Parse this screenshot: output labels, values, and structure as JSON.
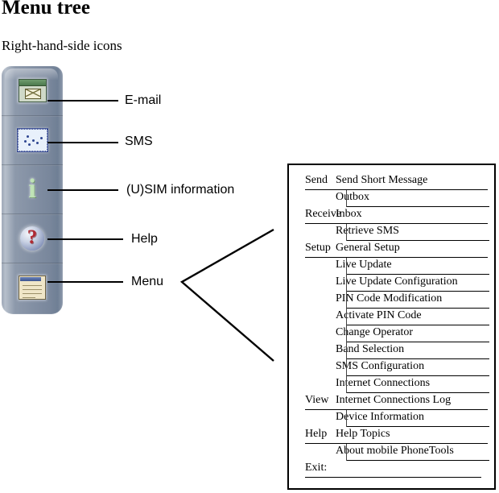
{
  "page": {
    "title": "Menu tree",
    "subtitle": "Right-hand-side icons"
  },
  "toolbar": {
    "name": "right-hand-side-icon-bar",
    "buttons": [
      {
        "icon": "email-icon",
        "label": "E-mail"
      },
      {
        "icon": "sms-icon",
        "label": "SMS"
      },
      {
        "icon": "usim-information-icon",
        "label": "(U)SIM information"
      },
      {
        "icon": "help-icon",
        "label": "Help"
      },
      {
        "icon": "menu-icon",
        "label": "Menu"
      }
    ]
  },
  "menu_tree": {
    "rows": [
      {
        "category": "Send",
        "item": "Send Short Message",
        "indent": 0
      },
      {
        "category": "",
        "item": "Outbox",
        "indent": 1
      },
      {
        "category": "Receive",
        "item": "Inbox",
        "indent": 0
      },
      {
        "category": "",
        "item": "Retrieve SMS",
        "indent": 1
      },
      {
        "category": "Setup",
        "item": "General Setup",
        "indent": 0
      },
      {
        "category": "",
        "item": "Live Update",
        "indent": 1
      },
      {
        "category": "",
        "item": "Live Update Configuration",
        "indent": 1
      },
      {
        "category": "",
        "item": "PIN Code Modification",
        "indent": 1
      },
      {
        "category": "",
        "item": "Activate PIN Code",
        "indent": 1
      },
      {
        "category": "",
        "item": "Change Operator",
        "indent": 1
      },
      {
        "category": "",
        "item": "Band Selection",
        "indent": 1
      },
      {
        "category": "",
        "item": "SMS Configuration",
        "indent": 1
      },
      {
        "category": "",
        "item": "Internet Connections",
        "indent": 1
      },
      {
        "category": "View",
        "item": "Internet Connections Log",
        "indent": 0
      },
      {
        "category": "",
        "item": "Device Information",
        "indent": 1
      },
      {
        "category": "Help",
        "item": "Help Topics",
        "indent": 0
      },
      {
        "category": "",
        "item": "About mobile PhoneTools",
        "indent": 1
      },
      {
        "category": "Exit:",
        "item": "",
        "indent": 0
      }
    ]
  },
  "colors": {
    "toolbar_base": "#8d99ab",
    "toolbar_shadow": "#6f7f95",
    "email_green": "#4d7a4e",
    "sms_blue": "#2f4691",
    "help_red": "#b02a33",
    "menu_beige": "#f0e6c8",
    "line": "#000000"
  }
}
